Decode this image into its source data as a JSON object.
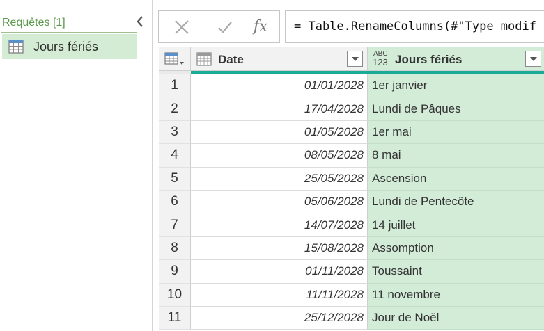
{
  "queries_pane": {
    "header": "Requêtes [1]",
    "collapse_icon": "chevron-left-icon",
    "items": [
      {
        "label": "Jours fériés",
        "icon": "table-icon"
      }
    ]
  },
  "formula_bar": {
    "cancel_icon": "x-icon",
    "commit_icon": "checkmark-icon",
    "fx_label": "fx",
    "formula": "= Table.RenameColumns(#\"Type modif"
  },
  "table": {
    "columns": [
      {
        "name": "Date",
        "type_icon": "calendar-table-icon"
      },
      {
        "name": "Jours fériés",
        "type_icon": "abc-123-icon"
      }
    ],
    "rows": [
      {
        "num": "1",
        "date": "01/01/2028",
        "jour": "1er janvier"
      },
      {
        "num": "2",
        "date": "17/04/2028",
        "jour": "Lundi de Pâques"
      },
      {
        "num": "3",
        "date": "01/05/2028",
        "jour": "1er mai"
      },
      {
        "num": "4",
        "date": "08/05/2028",
        "jour": "8 mai"
      },
      {
        "num": "5",
        "date": "25/05/2028",
        "jour": "Ascension"
      },
      {
        "num": "6",
        "date": "05/06/2028",
        "jour": "Lundi de Pentecôte"
      },
      {
        "num": "7",
        "date": "14/07/2028",
        "jour": "14 juillet"
      },
      {
        "num": "8",
        "date": "15/08/2028",
        "jour": "Assomption"
      },
      {
        "num": "9",
        "date": "01/11/2028",
        "jour": "Toussaint"
      },
      {
        "num": "10",
        "date": "11/11/2028",
        "jour": "11 novembre"
      },
      {
        "num": "11",
        "date": "25/12/2028",
        "jour": "Jour de Noël"
      }
    ]
  },
  "colors": {
    "selected_column": "#d3ecd8",
    "quality_bar": "#1aab96",
    "query_selected": "#d5ecd4",
    "queries_header_text": "#5b9a4c"
  }
}
